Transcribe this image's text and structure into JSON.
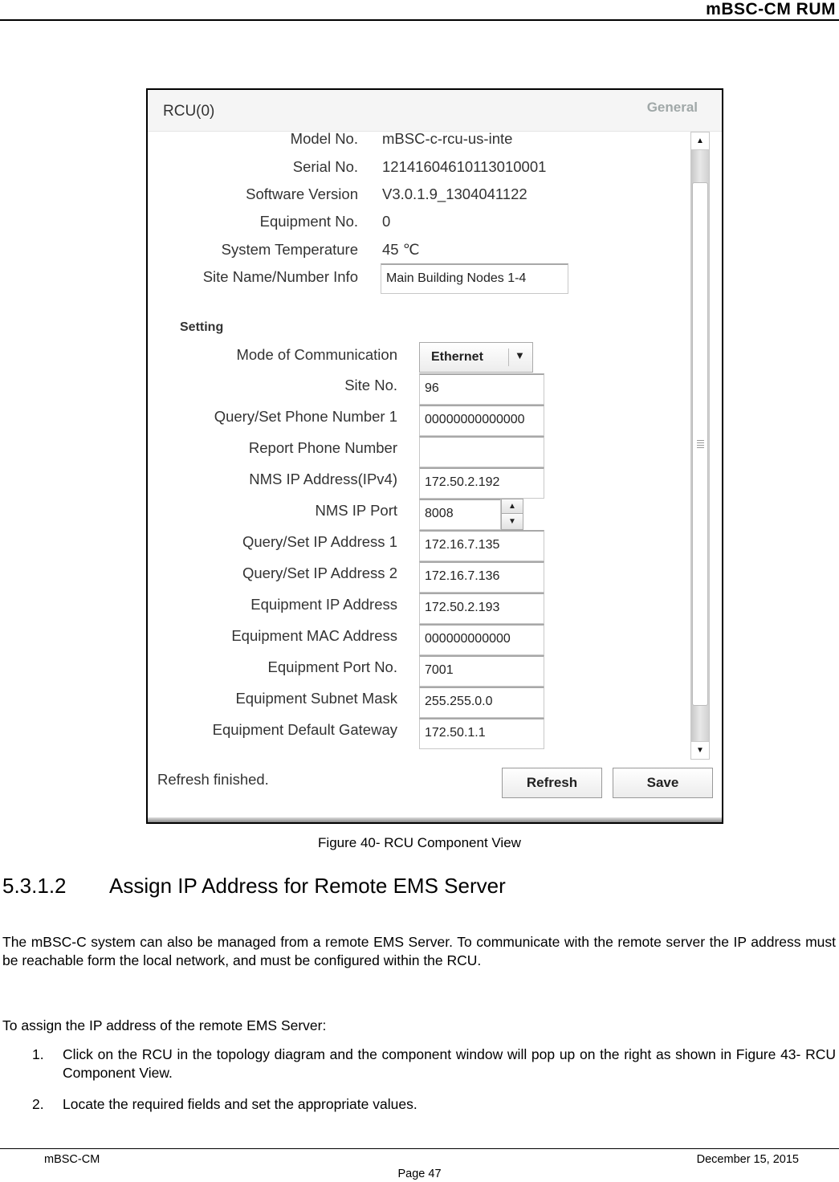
{
  "header": {
    "title": "mBSC-CM  RUM"
  },
  "figure": {
    "window_title": "RCU(0)",
    "tab_label": "General",
    "info_rows": [
      {
        "label": "Model No.",
        "value": "mBSC-c-rcu-us-inte"
      },
      {
        "label": "Serial No.",
        "value": "12141604610113010001"
      },
      {
        "label": "Software Version",
        "value": "V3.0.1.9_1304041122"
      },
      {
        "label": "Equipment No.",
        "value": "0"
      },
      {
        "label": "System Temperature",
        "value": "45   ℃"
      }
    ],
    "site_name": {
      "label": "Site Name/Number Info",
      "value": "Main Building Nodes 1-4"
    },
    "setting_heading": "Setting",
    "mode_of_communication": {
      "label": "Mode of Communication",
      "selected": "Ethernet",
      "arrow": "▼"
    },
    "setting_fields": [
      {
        "label": "Site No.",
        "value": "96"
      },
      {
        "label": "Query/Set Phone Number 1",
        "value": "00000000000000"
      },
      {
        "label": "Report Phone Number",
        "value": ""
      },
      {
        "label": "NMS IP Address(IPv4)",
        "value": "172.50.2.192"
      }
    ],
    "nms_ip_port": {
      "label": "NMS IP Port",
      "value": "8008",
      "up": "▲",
      "down": "▼"
    },
    "network_fields": [
      {
        "label": "Query/Set IP Address 1",
        "value": "172.16.7.135"
      },
      {
        "label": "Query/Set IP Address 2",
        "value": "172.16.7.136"
      },
      {
        "label": "Equipment IP Address",
        "value": "172.50.2.193"
      },
      {
        "label": "Equipment MAC Address",
        "value": "000000000000"
      },
      {
        "label": "Equipment Port No.",
        "value": "7001"
      },
      {
        "label": "Equipment Subnet Mask",
        "value": "255.255.0.0"
      },
      {
        "label": "Equipment Default Gateway",
        "value": "172.50.1.1"
      }
    ],
    "scrollbar": {
      "up": "▲",
      "down": "▼"
    },
    "status": "Refresh finished.",
    "buttons": {
      "refresh": "Refresh",
      "save": "Save"
    }
  },
  "caption": "Figure 40- RCU Component View",
  "section": {
    "number": "5.3.1.2",
    "title": "Assign IP Address for Remote EMS Server"
  },
  "paragraphs": [
    "The mBSC-C system can also be managed from a remote EMS Server. To communicate with the remote server the IP address must be reachable form the local network, and must be configured within the RCU.",
    "To assign the IP address of the remote EMS Server:"
  ],
  "steps": [
    {
      "num": "1.",
      "text": "Click on the RCU in the topology diagram and the component window will pop up on the right as shown in Figure 43- RCU Component View."
    },
    {
      "num": "2.",
      "text": "Locate the required fields and set the appropriate values."
    }
  ],
  "footer": {
    "left": "mBSC-CM",
    "right": "December 15, 2015",
    "page": "Page 47"
  }
}
